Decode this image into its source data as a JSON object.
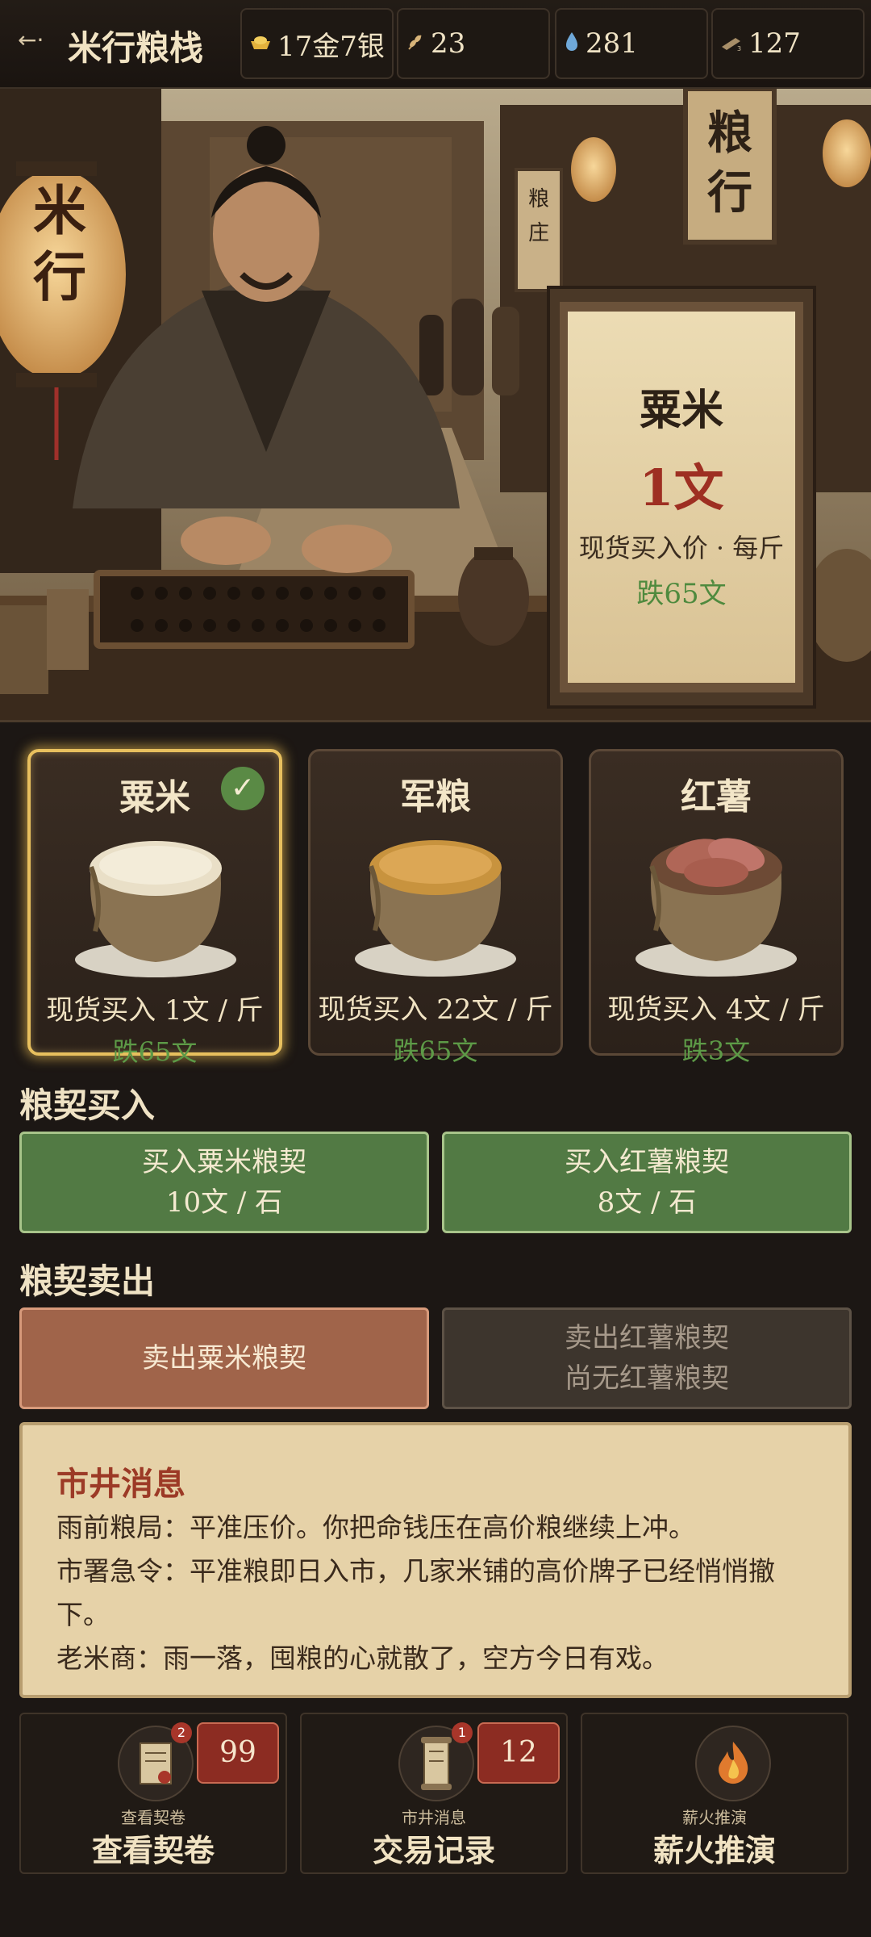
{
  "header": {
    "title": "米行粮栈",
    "stats": [
      {
        "icon": "gold-ingot-icon",
        "value": "17金7银"
      },
      {
        "icon": "grain-icon",
        "value": "23"
      },
      {
        "icon": "water-drop-icon",
        "value": "281"
      },
      {
        "icon": "contract-icon",
        "value": "127"
      }
    ]
  },
  "hero": {
    "lantern_text": "米行",
    "banner_text": "粮行",
    "small_sign_text": "粮庄",
    "price_sign": {
      "name": "粟米",
      "price": "1文",
      "label": "现货买入价 · 每斤",
      "change": "跌65文"
    }
  },
  "grains": [
    {
      "name": "粟米",
      "price": "现货买入 1文 / 斤",
      "change": "跌65文",
      "selected": true
    },
    {
      "name": "军粮",
      "price": "现货买入 22文 / 斤",
      "change": "跌65文",
      "selected": false
    },
    {
      "name": "红薯",
      "price": "现货买入 4文 / 斤",
      "change": "跌3文",
      "selected": false
    }
  ],
  "buy_section": {
    "title": "粮契买入",
    "buttons": [
      {
        "label": "买入粟米粮契",
        "price": "10文 / 石"
      },
      {
        "label": "买入红薯粮契",
        "price": "8文 / 石"
      }
    ]
  },
  "sell_section": {
    "title": "粮契卖出",
    "buttons": [
      {
        "label": "卖出粟米粮契"
      },
      {
        "label": "卖出红薯粮契",
        "note": "尚无红薯粮契"
      }
    ]
  },
  "news": {
    "title": "市井消息",
    "lines": [
      "雨前粮局：平准压价。你把命钱压在高价粮继续上冲。",
      "市署急令：平准粮即日入市，几家米铺的高价牌子已经悄悄撤",
      "下。",
      "老米商：雨一落，囤粮的心就散了，空方今日有戏。"
    ]
  },
  "nav": [
    {
      "small": "查看契卷",
      "label": "查看契卷",
      "count": "99",
      "badge": "2",
      "icon": "scroll-icon"
    },
    {
      "small": "市井消息",
      "label": "交易记录",
      "count": "12",
      "badge": "1",
      "icon": "scroll-icon"
    },
    {
      "small": "薪火推演",
      "label": "薪火推演",
      "icon": "fire-icon"
    }
  ],
  "colors": {
    "background": "#1c1714",
    "accent_gold": "#e8c05e",
    "buy_green": "#527a44",
    "sell_orange": "#a0644a",
    "price_red": "#9e2f22",
    "drop_green": "#5d9a47"
  }
}
